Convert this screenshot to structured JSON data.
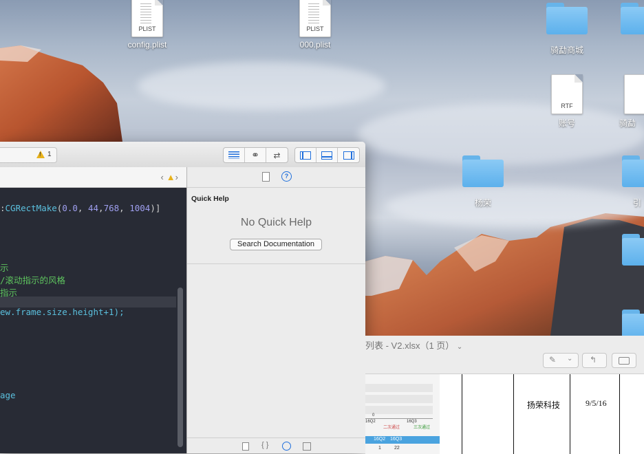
{
  "desktop": {
    "icons": [
      {
        "label": "config.plist",
        "type": "PLIST"
      },
      {
        "label": "000.plist",
        "type": "PLIST"
      },
      {
        "label": "骑勐商城"
      },
      {
        "label": "账号",
        "type": "RTF"
      },
      {
        "label": "骑勐"
      },
      {
        "label": "杨荣"
      },
      {
        "label": "引"
      }
    ]
  },
  "xcode": {
    "toolbar": {
      "warning_count": "1"
    },
    "code_lines": [
      {
        "text": ":CGRectMake(",
        "parts": [
          "0.0",
          "44",
          "768",
          "1004"
        ]
      },
      {
        "text": "示"
      },
      {
        "text": "/滚动指示的风格"
      },
      {
        "text": "指示"
      },
      {
        "text": "ew.frame.size.height+1);"
      },
      {
        "text": "age"
      }
    ],
    "inspector": {
      "section_title": "Quick Help",
      "empty_message": "No Quick Help",
      "search_button": "Search Documentation"
    }
  },
  "preview": {
    "title": "列表 - V2.xlsx（1 页）",
    "table_cells": {
      "company": "扬荣科技",
      "date": "9/5/16"
    },
    "thumbnail": {
      "labels": [
        "16Q2",
        "16Q3",
        "0",
        "二次通过",
        "三次通过"
      ],
      "row_values": [
        "16Q2",
        "16Q3"
      ],
      "row_numbers": [
        "1",
        "22"
      ]
    }
  }
}
